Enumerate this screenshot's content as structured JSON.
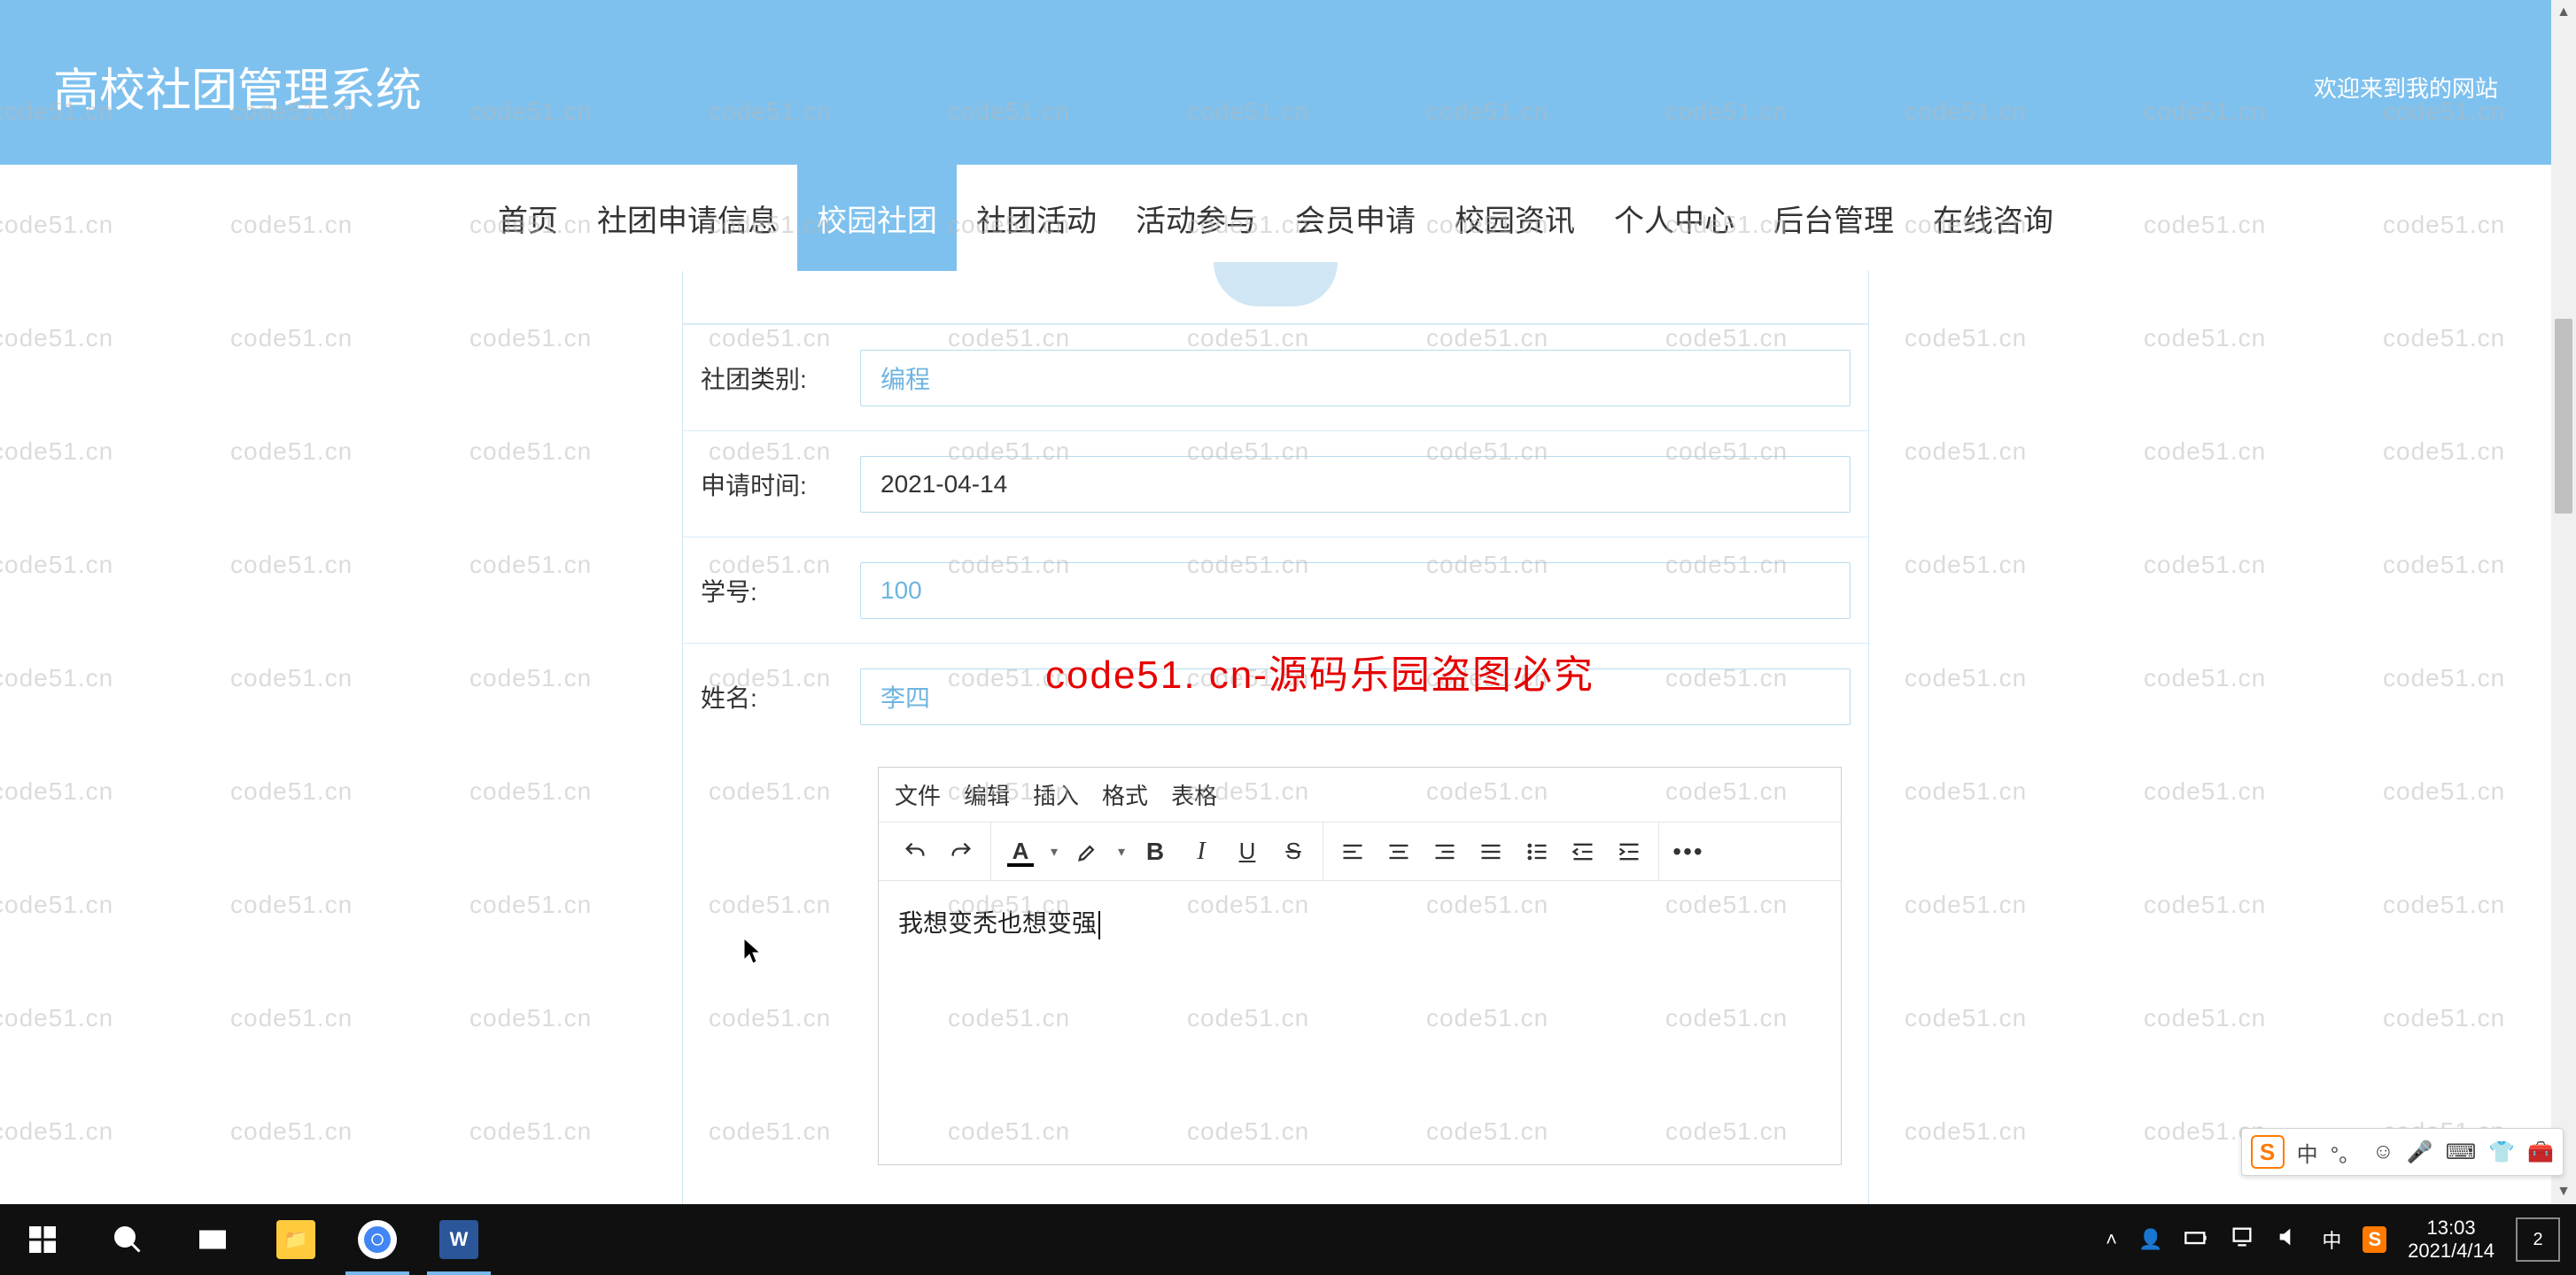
{
  "watermark_text": "code51.cn",
  "watermark_center": "code51. cn-源码乐园盗图必究",
  "header": {
    "title": "高校社团管理系统",
    "welcome": "欢迎来到我的网站"
  },
  "nav": {
    "items": [
      {
        "label": "首页"
      },
      {
        "label": "社团申请信息"
      },
      {
        "label": "校园社团"
      },
      {
        "label": "社团活动"
      },
      {
        "label": "活动参与"
      },
      {
        "label": "会员申请"
      },
      {
        "label": "校园资讯"
      },
      {
        "label": "个人中心"
      },
      {
        "label": "后台管理"
      },
      {
        "label": "在线咨询"
      }
    ],
    "active_index": 2
  },
  "form": {
    "category": {
      "label": "社团类别:",
      "value": "编程"
    },
    "apply_time": {
      "label": "申请时间:",
      "value": "2021-04-14"
    },
    "student_id": {
      "label": "学号:",
      "value": "100"
    },
    "name": {
      "label": "姓名:",
      "value": "李四"
    }
  },
  "editor": {
    "menu": {
      "file": "文件",
      "edit": "编辑",
      "insert": "插入",
      "format": "格式",
      "table": "表格"
    },
    "content": "我想变秃也想变强"
  },
  "ime": {
    "logo": "S",
    "lang": "中",
    "dot": "°。"
  },
  "taskbar": {
    "time": "13:03",
    "date": "2021/4/14",
    "ime_label": "中",
    "notif_count": "2"
  }
}
